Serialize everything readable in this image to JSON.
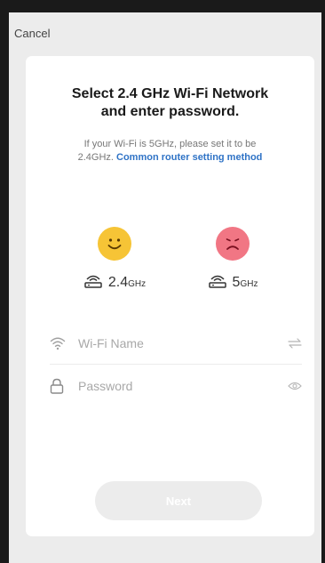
{
  "header": {
    "cancel_label": "Cancel"
  },
  "card": {
    "title_line1": "Select 2.4 GHz Wi-Fi Network",
    "title_line2": "and enter password.",
    "subtitle_line1": "If your Wi-Fi is 5GHz, please set it to be",
    "subtitle_prefix": "2.4GHz.",
    "subtitle_link": "Common router setting method"
  },
  "bands": [
    {
      "value": "2.4",
      "unit": "GHz",
      "face": "happy-face-icon",
      "color": "#f6c436"
    },
    {
      "value": "5",
      "unit": "GHz",
      "face": "sad-face-icon",
      "color": "#f17684"
    }
  ],
  "form": {
    "wifi_name": {
      "placeholder": "Wi-Fi Name",
      "value": "",
      "leading_icon": "wifi-icon",
      "trailing_icon": "switch-network-icon"
    },
    "password": {
      "placeholder": "Password",
      "value": "",
      "leading_icon": "lock-icon",
      "trailing_icon": "eye-icon"
    }
  },
  "next_button": {
    "label": "Next",
    "enabled": false
  },
  "colors": {
    "accent_link": "#2f73c6",
    "disabled_button": "#ececec",
    "background": "#ececec"
  }
}
